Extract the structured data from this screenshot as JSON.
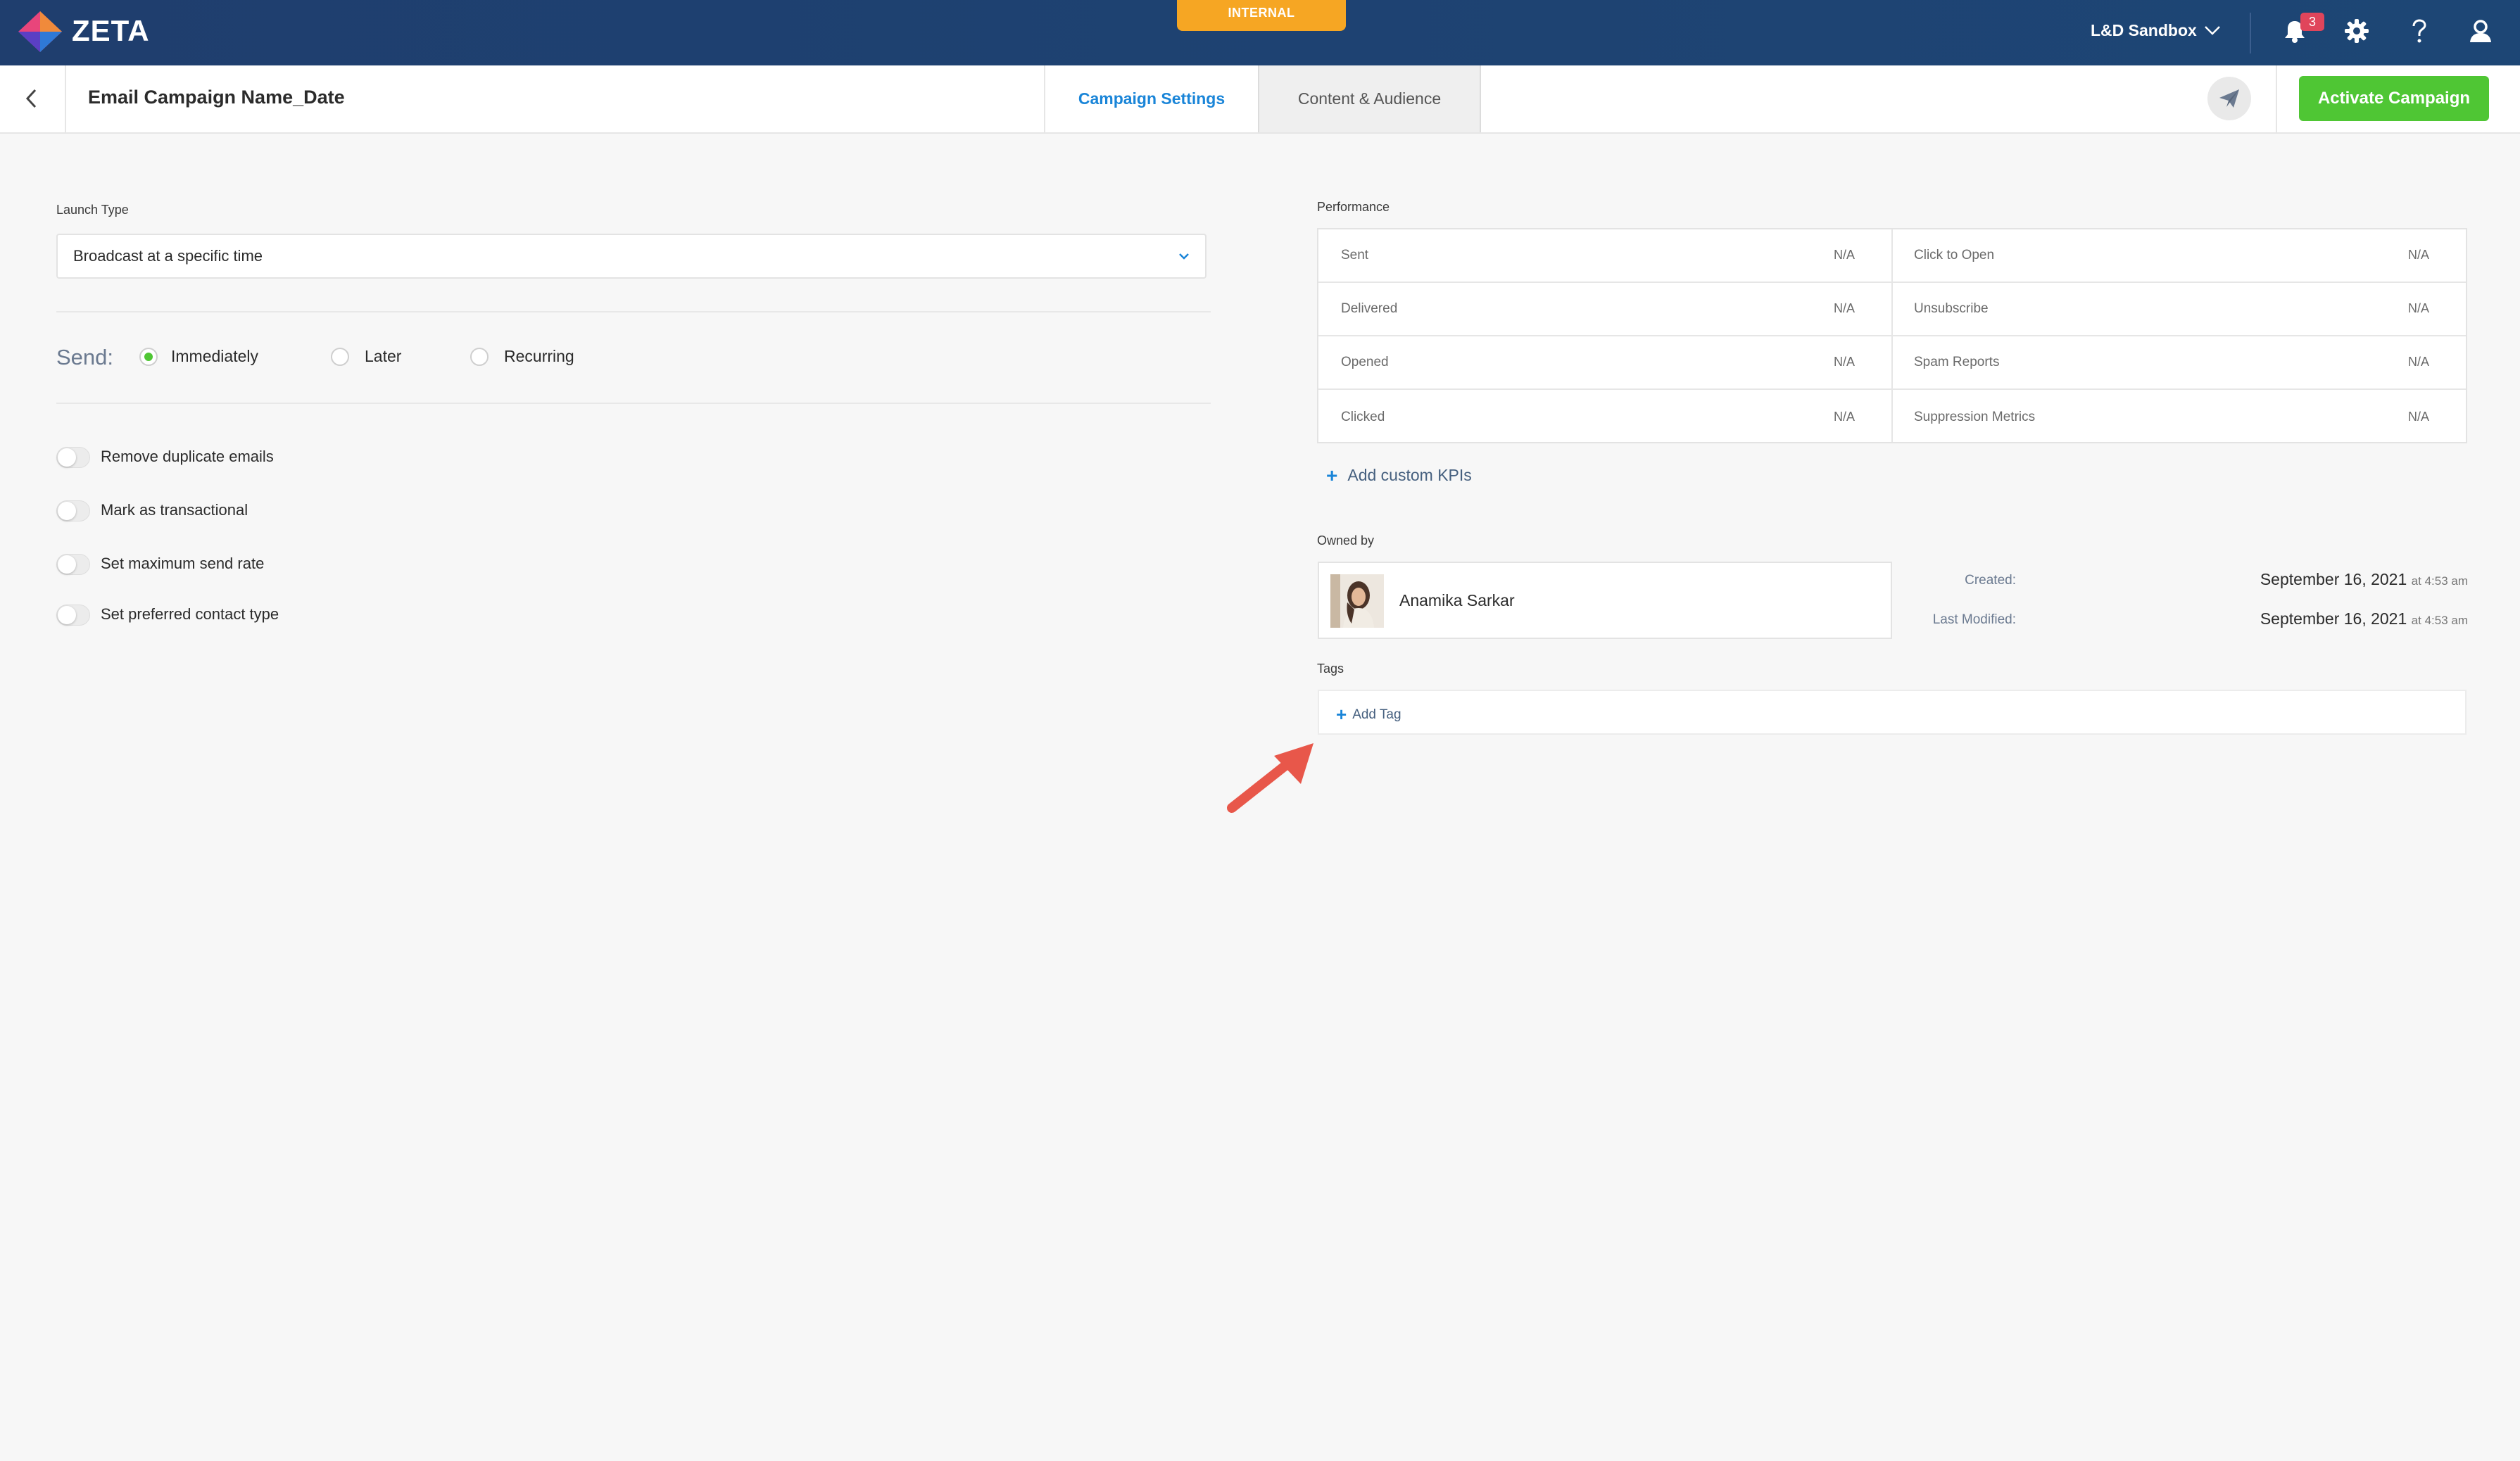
{
  "app": {
    "name": "ZETA",
    "environment_badge": "INTERNAL",
    "org_selector": "L&D Sandbox",
    "notification_count": "3"
  },
  "header": {
    "title": "Email Campaign Name_Date",
    "tabs": [
      {
        "label": "Campaign Settings",
        "active": true
      },
      {
        "label": "Content & Audience",
        "active": false
      }
    ],
    "activate_label": "Activate Campaign"
  },
  "settings": {
    "launch_type_label": "Launch Type",
    "launch_type_value": "Broadcast at a specific time",
    "send_label": "Send:",
    "send_options": [
      {
        "label": "Immediately",
        "selected": true
      },
      {
        "label": "Later",
        "selected": false
      },
      {
        "label": "Recurring",
        "selected": false
      }
    ],
    "toggles": [
      {
        "label": "Remove duplicate emails",
        "on": false
      },
      {
        "label": "Mark as transactional",
        "on": false
      },
      {
        "label": "Set maximum send rate",
        "on": false
      },
      {
        "label": "Set preferred contact type",
        "on": false
      }
    ]
  },
  "performance": {
    "label": "Performance",
    "left": [
      {
        "name": "Sent",
        "value": "N/A"
      },
      {
        "name": "Delivered",
        "value": "N/A"
      },
      {
        "name": "Opened",
        "value": "N/A"
      },
      {
        "name": "Clicked",
        "value": "N/A"
      }
    ],
    "right": [
      {
        "name": "Click to Open",
        "value": "N/A"
      },
      {
        "name": "Unsubscribe",
        "value": "N/A"
      },
      {
        "name": "Spam Reports",
        "value": "N/A"
      },
      {
        "name": "Suppression Metrics",
        "value": "N/A"
      }
    ],
    "add_kpi_label": "Add custom KPIs"
  },
  "ownership": {
    "owned_by_label": "Owned by",
    "owner_name": "Anamika Sarkar",
    "created_label": "Created:",
    "created_date": "September 16, 2021",
    "created_time": "at 4:53 am",
    "modified_label": "Last Modified:",
    "modified_date": "September 16, 2021",
    "modified_time": "at 4:53 am"
  },
  "tags": {
    "label": "Tags",
    "add_label": "Add Tag"
  },
  "colors": {
    "nav": "#1f3e6e",
    "accent_blue": "#1a85d8",
    "activate_green": "#4fc634",
    "internal_orange": "#f6a623",
    "annotation_arrow": "#e8574a"
  }
}
